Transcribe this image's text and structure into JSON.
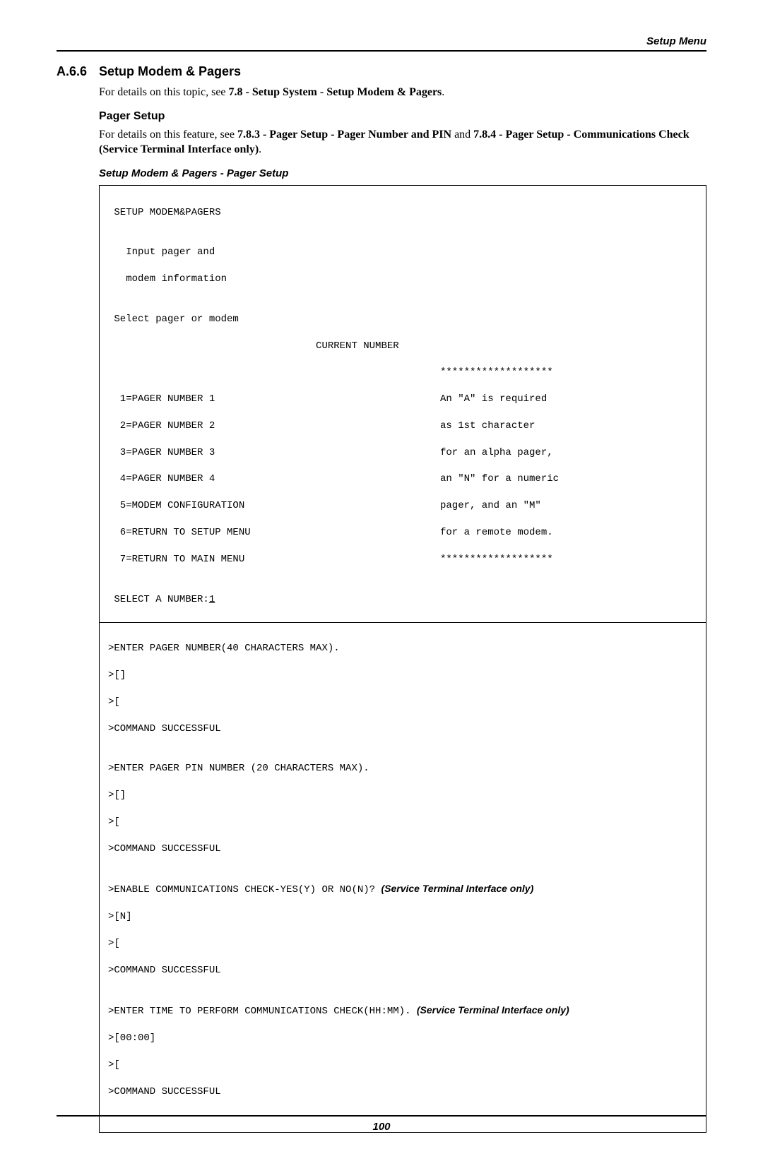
{
  "header": {
    "right": "Setup Menu"
  },
  "section": {
    "number": "A.6.6",
    "title": "Setup Modem & Pagers",
    "para1_prefix": "For details on this topic, see ",
    "para1_bold": "7.8 - Setup System - Setup Modem & Pagers",
    "para1_suffix": "."
  },
  "sub": {
    "title": "Pager Setup",
    "p_prefix": "For details on this feature, see ",
    "p_bold1": "7.8.3 - Pager Setup - Pager Number and PIN",
    "p_mid": " and ",
    "p_bold2": "7.8.4 - Pager Setup - Communications Check (Service Terminal Interface only)",
    "p_suffix": "."
  },
  "caption": "Setup Modem & Pagers - Pager Setup",
  "term": {
    "title": " SETUP MODEM&PAGERS",
    "line_input1": "   Input pager and",
    "line_input2": "   modem information",
    "select_line": " Select pager or modem",
    "current_number": "                                   CURRENT NUMBER",
    "stars": "*******************",
    "menu": {
      "i1": "  1=PAGER NUMBER 1",
      "i2": "  2=PAGER NUMBER 2",
      "i3": "  3=PAGER NUMBER 3",
      "i4": "  4=PAGER NUMBER 4",
      "i5": "  5=MODEM CONFIGURATION",
      "i6": "  6=RETURN TO SETUP MENU",
      "i7": "  7=RETURN TO MAIN MENU"
    },
    "note": {
      "n1": "An \"A\" is required",
      "n2": "as 1st character",
      "n3": "for an alpha pager,",
      "n4": "an \"N\" for a numeric",
      "n5": "pager, and an \"M\"",
      "n6": "for a remote modem."
    },
    "select_prompt": " SELECT A NUMBER:",
    "select_value": "1",
    "lower": {
      "l1": ">ENTER PAGER NUMBER(40 CHARACTERS MAX).",
      "l2": ">[]",
      "l3": ">[",
      "l4": ">COMMAND SUCCESSFUL",
      "blank": "",
      "l5": ">ENTER PAGER PIN NUMBER (20 CHARACTERS MAX).",
      "l6": ">[]",
      "l7": ">[",
      "l8": ">COMMAND SUCCESSFUL",
      "l9a": ">ENABLE COMMUNICATIONS CHECK-YES(Y) OR NO(N)? ",
      "l9b": "(Service Terminal Interface only)",
      "l10": ">[N]",
      "l11": ">[",
      "l12": ">COMMAND SUCCESSFUL",
      "l13a": ">ENTER TIME TO PERFORM COMMUNICATIONS CHECK(HH:MM). ",
      "l13b": "(Service Terminal Interface only)",
      "l14": ">[00:00]",
      "l15": ">[",
      "l16": ">COMMAND SUCCESSFUL"
    }
  },
  "footer": {
    "page": "100"
  }
}
